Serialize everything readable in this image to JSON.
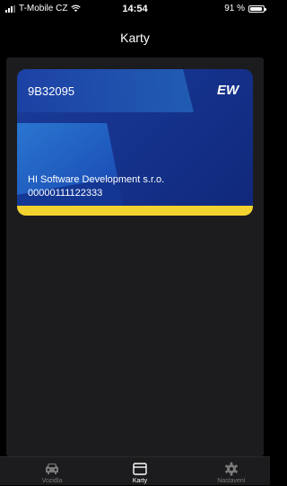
{
  "status_bar": {
    "carrier": "T-Mobile CZ",
    "time": "14:54",
    "battery": "91 %",
    "battery_level": 0.91
  },
  "nav": {
    "title": "Karty"
  },
  "card": {
    "code": "9B32095",
    "logo_text": "EW",
    "company": "HI Software Development s.r.o.",
    "number": "00000111122333",
    "colors": {
      "primary": "#1b3c9b",
      "accent_light": "#2f7fd1",
      "stripe_yellow": "#f2d22e"
    }
  },
  "tabs": [
    {
      "label": "Vozidla",
      "icon": "car-icon",
      "active": false
    },
    {
      "label": "Karty",
      "icon": "card-icon",
      "active": true
    },
    {
      "label": "Nastavení",
      "icon": "gear-icon",
      "active": false
    }
  ]
}
